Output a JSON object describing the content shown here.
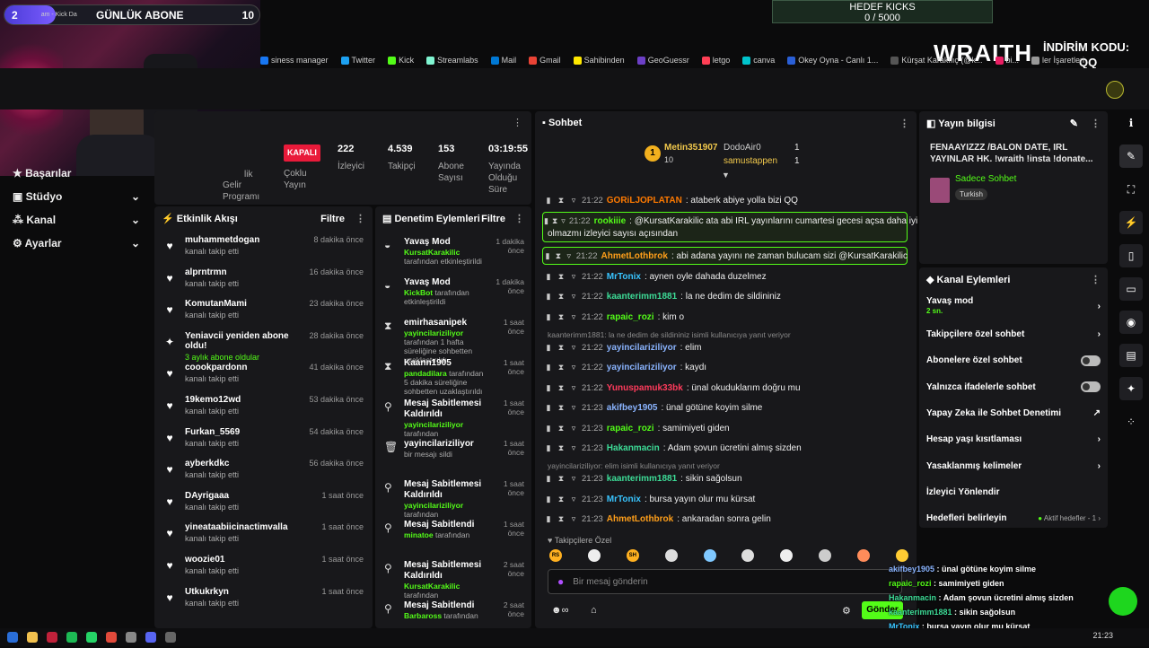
{
  "goal_bar": {
    "count": "2",
    "label": "GÜNLÜK ABONE",
    "target": "10",
    "progress": 0.2,
    "tab_text": "am - Kick Da"
  },
  "kicks_goal": {
    "title": "HEDEF KICKS",
    "value": "0 / 5000"
  },
  "promo": {
    "brand": "WRAITH.",
    "code_label": "İNDİRİM KODU:",
    "code": "QQ"
  },
  "bookmarks": [
    {
      "label": "siness manager",
      "color": "#1877f2"
    },
    {
      "label": "Twitter",
      "color": "#1da1f2"
    },
    {
      "label": "Kick",
      "color": "#53fc18"
    },
    {
      "label": "Streamlabs",
      "color": "#80f5d2"
    },
    {
      "label": "Mail",
      "color": "#0078d4"
    },
    {
      "label": "Gmail",
      "color": "#ea4335"
    },
    {
      "label": "Sahibinden",
      "color": "#ffe800"
    },
    {
      "label": "GeoGuessr",
      "color": "#6c3fc6"
    },
    {
      "label": "letgo",
      "color": "#ff3f55"
    },
    {
      "label": "canva",
      "color": "#00c4cc"
    },
    {
      "label": "Okey Oyna - Canlı 1...",
      "color": "#2a5fd6"
    },
    {
      "label": "Kürşat Karakılıç (@k...",
      "color": "#555555"
    },
    {
      "label": "bi...",
      "color": "#e91e63"
    },
    {
      "label": "ler İşaretleri",
      "color": "#999999"
    }
  ],
  "sidebar": {
    "items": [
      {
        "label": "Başarılar"
      },
      {
        "label": "Stüdyo"
      },
      {
        "label": "Kanal"
      },
      {
        "label": "Ayarlar"
      }
    ]
  },
  "stats": {
    "gelir": "Gelir\nProgramı",
    "kapali": "KAPALI",
    "coklu": "Çoklu\nYayın",
    "izleyici_val": "222",
    "izleyici": "İzleyici",
    "takipci_val": "4.539",
    "takipci": "Takipçi",
    "abone_val": "153",
    "abone": "Abone\nSayısı",
    "sure_val": "03:19:55",
    "sure": "Yayında\nOlduğu\nSüre",
    "ilk": "lik"
  },
  "feed": {
    "title": "Etkinlik Akışı",
    "filter": "Filtre",
    "items": [
      {
        "name": "muhammetdogan",
        "sub": "kanalı takip etti",
        "time": "8 dakika önce"
      },
      {
        "name": "alprntrmn",
        "sub": "kanalı takip etti",
        "time": "16 dakika önce"
      },
      {
        "name": "KomutanMami",
        "sub": "kanalı takip etti",
        "time": "23 dakika önce"
      },
      {
        "name": "Yeniavcii yeniden abone oldu!",
        "sub": "3 aylık abone oldular",
        "time": "28 dakika önce"
      },
      {
        "name": "coookpardonn",
        "sub": "kanalı takip etti",
        "time": "41 dakika önce"
      },
      {
        "name": "19kemo12wd",
        "sub": "kanalı takip etti",
        "time": "53 dakika önce"
      },
      {
        "name": "Furkan_5569",
        "sub": "kanalı takip etti",
        "time": "54 dakika önce"
      },
      {
        "name": "ayberkdkc",
        "sub": "kanalı takip etti",
        "time": "56 dakika önce"
      },
      {
        "name": "DAyrigaaa",
        "sub": "kanalı takip etti",
        "time": "1 saat önce"
      },
      {
        "name": "yineataabiicinactimvalla",
        "sub": "kanalı takip etti",
        "time": "1 saat önce"
      },
      {
        "name": "woozie01",
        "sub": "kanalı takip etti",
        "time": "1 saat önce"
      },
      {
        "name": "Utkukrkyn",
        "sub": "kanalı takip etti",
        "time": "1 saat önce"
      }
    ]
  },
  "mod": {
    "title": "Denetim Eylemleri",
    "filter": "Filtre",
    "items": [
      {
        "name": "Yavaş Mod",
        "user": "KursatKarakilic",
        "rest": " tarafından etkinleştirildi",
        "time": "1 dakika önce"
      },
      {
        "name": "Yavaş Mod",
        "user": "KickBot",
        "rest": " tarafından etkinleştirildi",
        "time": "1 dakika önce"
      },
      {
        "name": "emirhasanipek",
        "user": "yayincilariziliyor",
        "rest": " tarafından 1 hafta süreliğine sohbetten uzaklaştırıldı",
        "time": "1 saat önce"
      },
      {
        "name": "Kaann1905",
        "user": "pandadilara",
        "rest": " tarafından 5 dakika süreliğine sohbetten uzaklaştırıldı",
        "time": "1 saat önce"
      },
      {
        "name": "Mesaj Sabitlemesi Kaldırıldı",
        "user": "yayincilariziliyor",
        "rest": " tarafından",
        "time": "1 saat önce"
      },
      {
        "name": "yayincilariziliyor",
        "user": "",
        "rest": "bir mesajı sildi",
        "time": "1 saat önce"
      },
      {
        "name": "Mesaj Sabitlemesi Kaldırıldı",
        "user": "yayincilariziliyor",
        "rest": " tarafından",
        "time": "1 saat önce"
      },
      {
        "name": "Mesaj Sabitlendi",
        "user": "minatoe",
        "rest": " tarafından",
        "time": "1 saat önce"
      },
      {
        "name": "Mesaj Sabitlemesi Kaldırıldı",
        "user": "KursatKarakilic",
        "rest": " tarafından",
        "time": "2 saat önce"
      },
      {
        "name": "Mesaj Sabitlendi",
        "user": "Barbaross",
        "rest": " tarafından",
        "time": "2 saat önce"
      }
    ]
  },
  "chat": {
    "title": "Sohbet",
    "leader": {
      "first_name": "Metin351907",
      "first_count": "10",
      "second_name": "DodoAir0",
      "second_count": "1",
      "third_name": "samustappen",
      "third_count": "1"
    },
    "messages": [
      {
        "time": "21:22",
        "user": "GORiLJOPLATAN",
        "color": "#ff7a00",
        "text": ": ataberk abiye yolla bizi QQ"
      },
      {
        "time": "21:22",
        "user": "rookiiie",
        "color": "#53fc18",
        "text": ": @KursatKarakilic ata abi IRL yayınlarını cumartesi gecesi açsa daha iyi",
        "text2": "olmazmı izleyici sayısı açısından"
      },
      {
        "time": "21:22",
        "user": "AhmetLothbrok",
        "color": "#ff9f1a",
        "text": ": abi adana yayını ne zaman bulucam sizi @KursatKarakilic"
      },
      {
        "time": "21:22",
        "user": "MrTonix",
        "color": "#39c5ff",
        "text": ": aynen oyle dahada duzelmez"
      },
      {
        "time": "21:22",
        "user": "kaanterimm1881",
        "color": "#3ddc97",
        "text": ": la ne dedim de sildininiz"
      },
      {
        "time": "21:22",
        "user": "rapaic_rozi",
        "color": "#53fc18",
        "text": ": kim o"
      },
      {
        "time": "21:22",
        "user": "yayincilariziliyor",
        "color": "#8ab4ff",
        "text": ": elim"
      },
      {
        "time": "21:22",
        "user": "yayincilariziliyor",
        "color": "#8ab4ff",
        "text": ": kaydı"
      },
      {
        "time": "21:22",
        "user": "Yunuspamuk33bk",
        "color": "#ff3b5c",
        "text": ": ünal okuduklarım doğru mu"
      },
      {
        "time": "21:23",
        "user": "akifbey1905",
        "color": "#8ab4ff",
        "text": ": ünal götüne koyim silme"
      },
      {
        "time": "21:23",
        "user": "rapaic_rozi",
        "color": "#53fc18",
        "text": ": samimiyeti giden"
      },
      {
        "time": "21:23",
        "user": "Hakanmacin",
        "color": "#3ddc97",
        "text": ": Adam şovun ücretini almış sizden"
      },
      {
        "time": "21:23",
        "user": "kaanterimm1881",
        "color": "#3ddc97",
        "text": ": sikin sağolsun"
      },
      {
        "time": "21:23",
        "user": "MrTonix",
        "color": "#39c5ff",
        "text": ": bursa yayın olur mu kürsat"
      },
      {
        "time": "21:23",
        "user": "AhmetLothbrok",
        "color": "#ff9f1a",
        "text": ": ankaradan sonra gelin"
      }
    ],
    "reply1": "kaanterimm1881: la ne dedim de sildininiz isimli kullanıcıya yanıt veriyor",
    "reply2": "yayincilariziliyor: elim isimli kullanıcıya yanıt veriyor",
    "follower_only": "Takipçilere Özel",
    "emotes": [
      {
        "text": "RS",
        "color": "#ffb020"
      },
      {
        "text": "",
        "color": "#eeeeee"
      },
      {
        "text": "SH",
        "color": "#ffb020"
      },
      {
        "text": "",
        "color": "#dddddd"
      },
      {
        "text": "",
        "color": "#7fc8ff"
      },
      {
        "text": "",
        "color": "#dddddd"
      },
      {
        "text": "",
        "color": "#eeeeee"
      },
      {
        "text": "",
        "color": "#cccccc"
      },
      {
        "text": "",
        "color": "#ff8c5a"
      },
      {
        "text": "",
        "color": "#ffcc33"
      }
    ],
    "input_placeholder": "Bir mesaj gönderin",
    "send": "Gönder"
  },
  "info": {
    "title": "Yayın bilgisi",
    "stream_title": "FENAAYIZZZ /BALON DATE, IRL YAYINLAR HK. !wraith !insta !donate...",
    "category": "Sadece Sohbet",
    "tag": "Turkish"
  },
  "channel_actions": {
    "title": "Kanal Eylemleri",
    "slow_mode": "Yavaş mod",
    "slow_value": "2 sn.",
    "items": [
      {
        "label": "Takipçilere özel sohbet",
        "kind": "chevron"
      },
      {
        "label": "Abonelere özel sohbet",
        "kind": "toggle"
      },
      {
        "label": "Yalnızca ifadelerle sohbet",
        "kind": "toggle"
      },
      {
        "label": "Yapay Zeka ile Sohbet Denetimi",
        "kind": "external"
      },
      {
        "label": "Hesap yaşı kısıtlaması",
        "kind": "chevron"
      },
      {
        "label": "Yasaklanmış kelimeler",
        "kind": "chevron"
      },
      {
        "label": "İzleyici Yönlendir",
        "kind": "none"
      }
    ],
    "goals_label": "Hedefleri belirleyin",
    "goals_active": "Aktif hedefler - 1"
  },
  "overlay_chat": [
    {
      "user": "akifbey1905",
      "text": " : ünal götüne koyim silme",
      "color": "#8ab4ff"
    },
    {
      "user": "rapaic_rozi",
      "text": " : samimiyeti giden",
      "color": "#53fc18"
    },
    {
      "user": "Hakanmacin",
      "text": " : Adam şovun ücretini almış sizden",
      "color": "#3ddc97"
    },
    {
      "user": "kaanterimm1881",
      "text": " : sikin sağolsun",
      "color": "#3ddc97"
    },
    {
      "user": "MrTonix",
      "text": " : bursa yayın olur mu kürsat",
      "color": "#39c5ff"
    },
    {
      "user": "AhmetLothbrok",
      "text": " : ankaradan sonra gelin",
      "color": "#ff9f1a"
    }
  ],
  "clock": "21:23",
  "accent": "#53fc18"
}
